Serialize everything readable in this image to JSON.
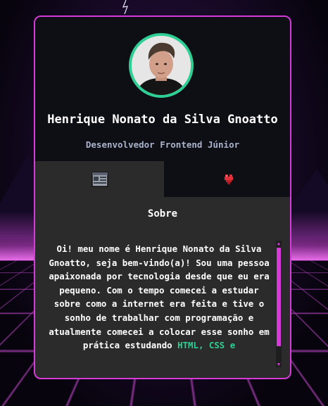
{
  "profile": {
    "name": "Henrique Nonato da Silva Gnoatto",
    "role": "Desenvolvedor Frontend Júnior"
  },
  "tabs": [
    {
      "icon": "browser-window-icon",
      "active": true
    },
    {
      "icon": "heart-icon",
      "active": false
    }
  ],
  "about": {
    "title": "Sobre",
    "text": "Oi! meu nome é Henrique Nonato da Silva Gnoatto, seja bem-vindo(a)! Sou uma pessoa apaixonada por tecnologia desde que eu era pequeno. Com o tempo comecei a estudar sobre como a internet era feita e tive o sonho de trabalhar com programação e atualmente comecei a colocar esse sonho em prática estudando ",
    "highlight": "HTML, CSS e"
  },
  "colors": {
    "accent": "#d63ad8",
    "avatar_ring": "#2ecf94",
    "highlight": "#2ecf94",
    "header_bg": "#0e0f14",
    "body_bg": "#2b2b2b"
  }
}
